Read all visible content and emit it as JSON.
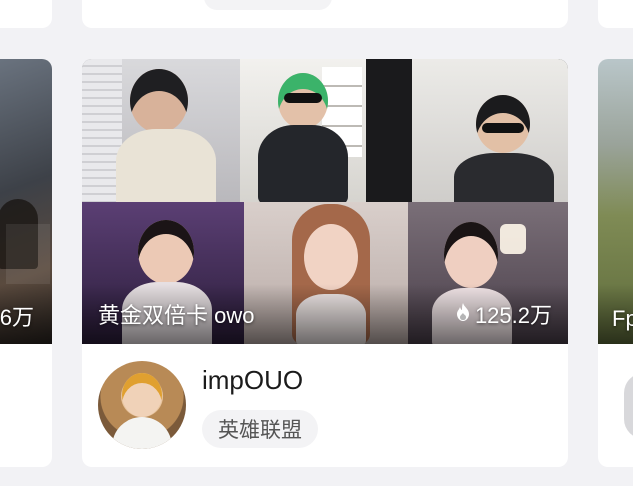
{
  "main_card": {
    "streamer_name": "impOUO",
    "category_tag": "英雄联盟",
    "overlay_title": "黄金双倍卡 owo",
    "viewer_count": "125.2万",
    "fire_icon": "flame-icon"
  },
  "left_card": {
    "viewer_count_partial": "6万"
  },
  "right_card": {
    "title_partial": "Fp"
  },
  "colors": {
    "page_bg": "#f2f2f5",
    "card_bg": "#ffffff",
    "tag_bg": "#f3f3f5",
    "text_primary": "#1b1b1b",
    "text_secondary": "#555555"
  }
}
